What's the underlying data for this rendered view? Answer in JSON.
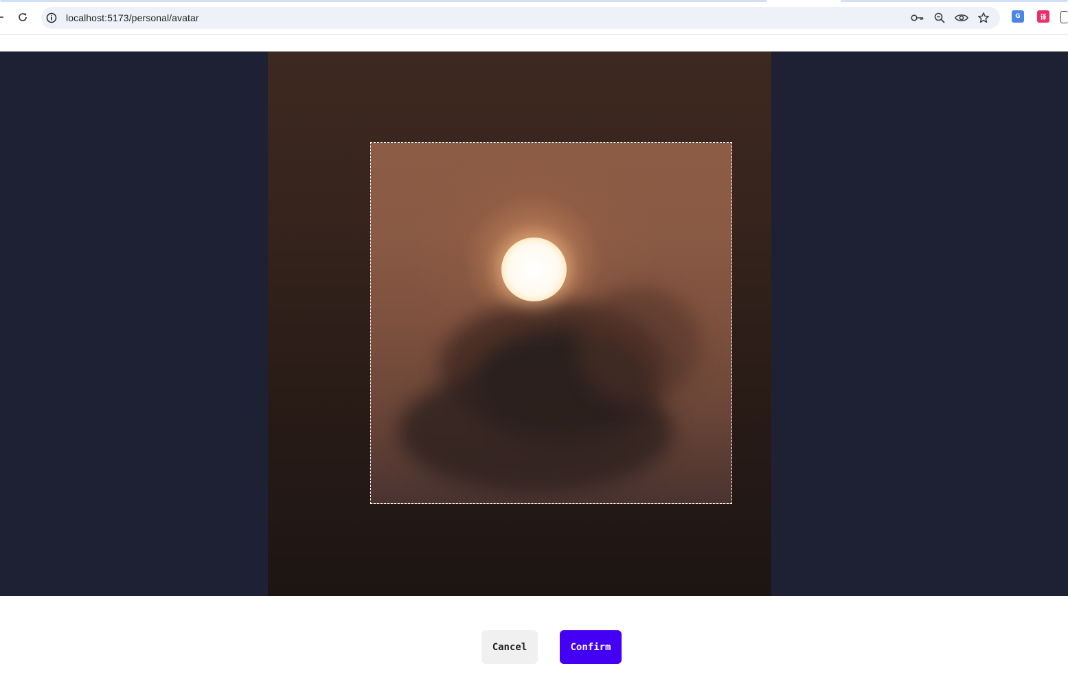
{
  "browser": {
    "url": "localhost:5173/personal/avatar",
    "icons": {
      "reload": "reload-icon",
      "site_info": "info-icon",
      "password": "key-icon",
      "zoom": "zoom-out-icon",
      "view": "eye-icon",
      "bookmark": "star-icon",
      "extension_translate": "google-translate-icon",
      "extension_other": "translate-extension-icon"
    },
    "extension_translate_glyph": "G",
    "extension_other_glyph": "译"
  },
  "cropper": {
    "background_color": "#1e2133",
    "crop_outline_color": "#ffffff"
  },
  "actions": {
    "cancel_label": "Cancel",
    "confirm_label": "Confirm",
    "confirm_color": "#4400f5"
  }
}
